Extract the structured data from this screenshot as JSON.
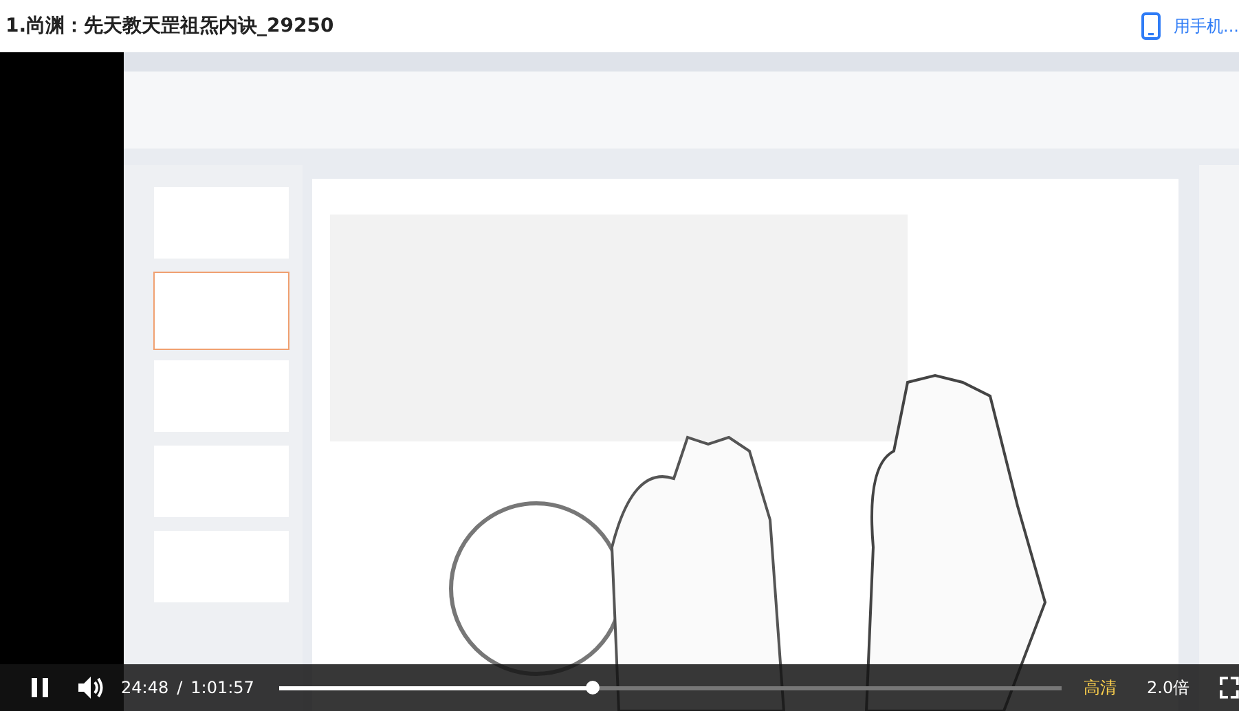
{
  "header": {
    "title": "1.尚渊：先天教天罡祖炁内诀_29250",
    "phone_link": "用手机..."
  },
  "controls": {
    "playing": true,
    "time": "24:48",
    "separator": "/",
    "duration": "1:01:57",
    "progress": {
      "level": 0.4
    },
    "quality": "高清",
    "speed": "2.0倍"
  }
}
